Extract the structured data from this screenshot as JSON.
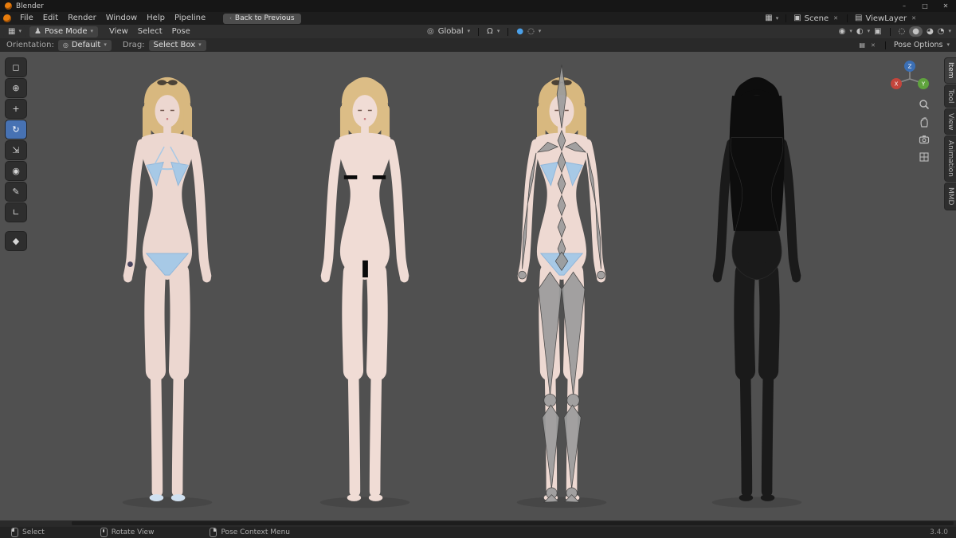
{
  "window": {
    "title": "Blender",
    "minimize": "–",
    "maximize": "□",
    "close": "✕"
  },
  "topbar": {
    "menus": [
      "File",
      "Edit",
      "Render",
      "Window",
      "Help",
      "Pipeline"
    ],
    "back_button": "Back to Previous",
    "scene_label": "Scene",
    "viewlayer_label": "ViewLayer"
  },
  "viewport_header": {
    "mode": "Pose Mode",
    "menus": [
      "View",
      "Select",
      "Pose"
    ],
    "orientation": "Global"
  },
  "tool_settings": {
    "orientation_label": "Orientation:",
    "orientation_value": "Default",
    "drag_label": "Drag:",
    "drag_value": "Select Box",
    "panel_label": "Pose Options"
  },
  "gizmo": {
    "x": "X",
    "y": "Y",
    "z": "Z"
  },
  "sidebar_tabs": [
    "Item",
    "Tool",
    "View",
    "Animation",
    "MMD"
  ],
  "status_bar": {
    "hint_select": "Select",
    "hint_rotate": "Rotate View",
    "hint_context": "Pose Context Menu",
    "version": "3.4.0"
  },
  "icons": {
    "chevron": "▾",
    "chevron_left": "‹",
    "editor": "▦",
    "scene": "▣",
    "layers": "▤",
    "close_small": "✕",
    "person": "♟",
    "pivot": "◎",
    "magnet": "Ω",
    "proportional": "◌",
    "snap_on": "●",
    "gizmos": "◉",
    "overlays": "◐",
    "xray": "▣",
    "wireframe": "◌",
    "solid": "●",
    "material": "◕",
    "rendered": "◔",
    "select": "◻",
    "cursor": "⊕",
    "move": "+",
    "rotate": "↻",
    "scale": "⇲",
    "transform": "◉",
    "annotate": "✎",
    "measure": "∟",
    "tweak": "◆"
  },
  "colors": {
    "accent": "#4772b3",
    "viewport_bg": "#505050",
    "skin": "#ecd7d0",
    "hair": "#d8b87f",
    "bikini": "#a7c9e6",
    "armature": "#9c9c9c",
    "wireframe": "#161616"
  }
}
